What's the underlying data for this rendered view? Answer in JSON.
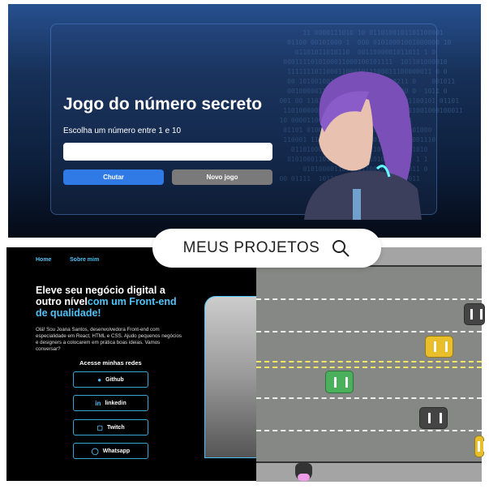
{
  "game_top": {
    "title": "Jogo do número secreto",
    "label": "Escolha um número entre 1 e 10",
    "input_value": "",
    "guess_button": "Chutar",
    "new_game_button": "Novo jogo",
    "colors": {
      "guess": "#2f7ae5",
      "new_game": "#7a7a7a"
    }
  },
  "banner": {
    "label": "MEUS PROJETOS",
    "icon": "search-icon"
  },
  "portfolio": {
    "nav": [
      "Home",
      "Sobre mim"
    ],
    "headline_main": "Eleve seu negócio digital a outro nível",
    "headline_highlight": "com um Front-end de qualidade!",
    "description": "Olá! Sou Joana Santos, desenvolvedora Front-end com especialidade em React, HTML e CSS. Ajudo pequenos negócios e designers a colocarem em prática boas ideias. Vamos conversar?",
    "social_title": "Acesse minhas redes",
    "social": [
      {
        "label": "Github",
        "icon": "github-icon"
      },
      {
        "label": "linkedin",
        "icon": "linkedin-icon"
      },
      {
        "label": "Twitch",
        "icon": "twitch-icon"
      },
      {
        "label": "Whatsapp",
        "icon": "whatsapp-icon"
      }
    ]
  }
}
